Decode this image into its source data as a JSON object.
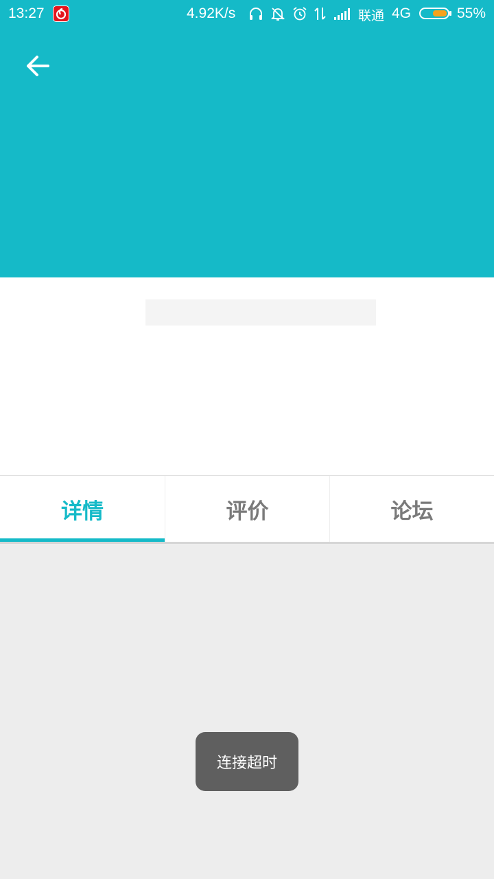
{
  "status_bar": {
    "time": "13:27",
    "app_icon": "netease-music-icon",
    "net_speed": "4.92K/s",
    "icons": [
      "headset-icon",
      "mute-bell-icon",
      "alarm-icon",
      "data-transfer-icon",
      "signal-icon"
    ],
    "carrier": "联通",
    "network": "4G",
    "battery_percent": "55%",
    "battery_level": 0.55,
    "battery_color": "#f7a21c"
  },
  "header": {
    "back_icon": "arrow-left-icon",
    "background_color": "#15bac8"
  },
  "tabs": [
    {
      "label": "详情",
      "active": true
    },
    {
      "label": "评价",
      "active": false
    },
    {
      "label": "论坛",
      "active": false
    }
  ],
  "toast": {
    "message": "连接超时"
  },
  "colors": {
    "accent": "#15bac8",
    "content_background": "#ededed",
    "toast_background": "#5f5f5f"
  }
}
